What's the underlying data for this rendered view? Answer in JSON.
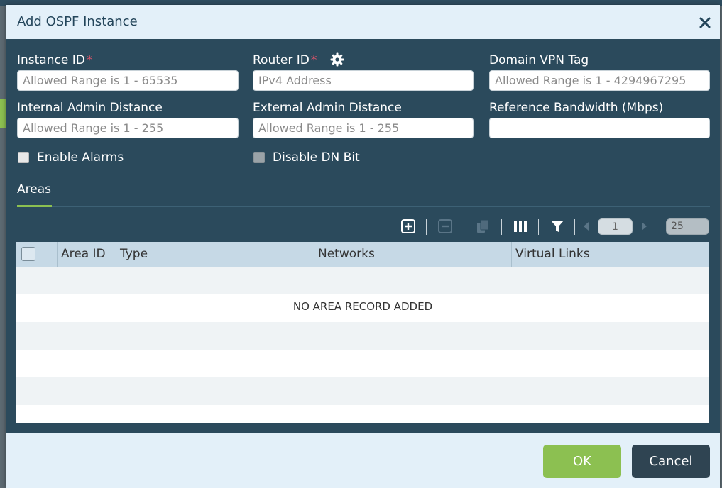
{
  "dialog": {
    "title": "Add OSPF Instance"
  },
  "fields": {
    "instance_id": {
      "label": "Instance ID",
      "required": "*",
      "placeholder": "Allowed Range is 1 - 65535"
    },
    "router_id": {
      "label": "Router ID",
      "required": "*",
      "placeholder": "IPv4 Address"
    },
    "domain_vpn_tag": {
      "label": "Domain VPN Tag",
      "placeholder": "Allowed Range is 1 - 4294967295"
    },
    "internal_admin_distance": {
      "label": "Internal Admin Distance",
      "placeholder": "Allowed Range is 1 - 255"
    },
    "external_admin_distance": {
      "label": "External Admin Distance",
      "placeholder": "Allowed Range is 1 - 255"
    },
    "reference_bandwidth": {
      "label": "Reference Bandwidth (Mbps)",
      "placeholder": ""
    }
  },
  "checkboxes": {
    "enable_alarms": {
      "label": "Enable Alarms",
      "checked": false
    },
    "disable_dn_bit": {
      "label": "Disable DN Bit",
      "checked": false
    }
  },
  "tabs": [
    {
      "label": "Areas",
      "active": true
    }
  ],
  "toolbar": {
    "icons": [
      "add-icon",
      "remove-icon",
      "copy-icon",
      "columns-icon",
      "filter-icon",
      "prev-page-icon",
      "next-page-icon"
    ],
    "page": "1",
    "page_size": "25"
  },
  "grid": {
    "columns": [
      "Area ID",
      "Type",
      "Networks",
      "Virtual Links"
    ],
    "empty_message": "NO AREA RECORD ADDED"
  },
  "footer": {
    "ok_label": "OK",
    "cancel_label": "Cancel"
  },
  "colors": {
    "header_bg": "#2b4a5c",
    "titlebar_bg": "#e3f0f9",
    "accent_green": "#8cc051",
    "required": "#e8546a"
  }
}
